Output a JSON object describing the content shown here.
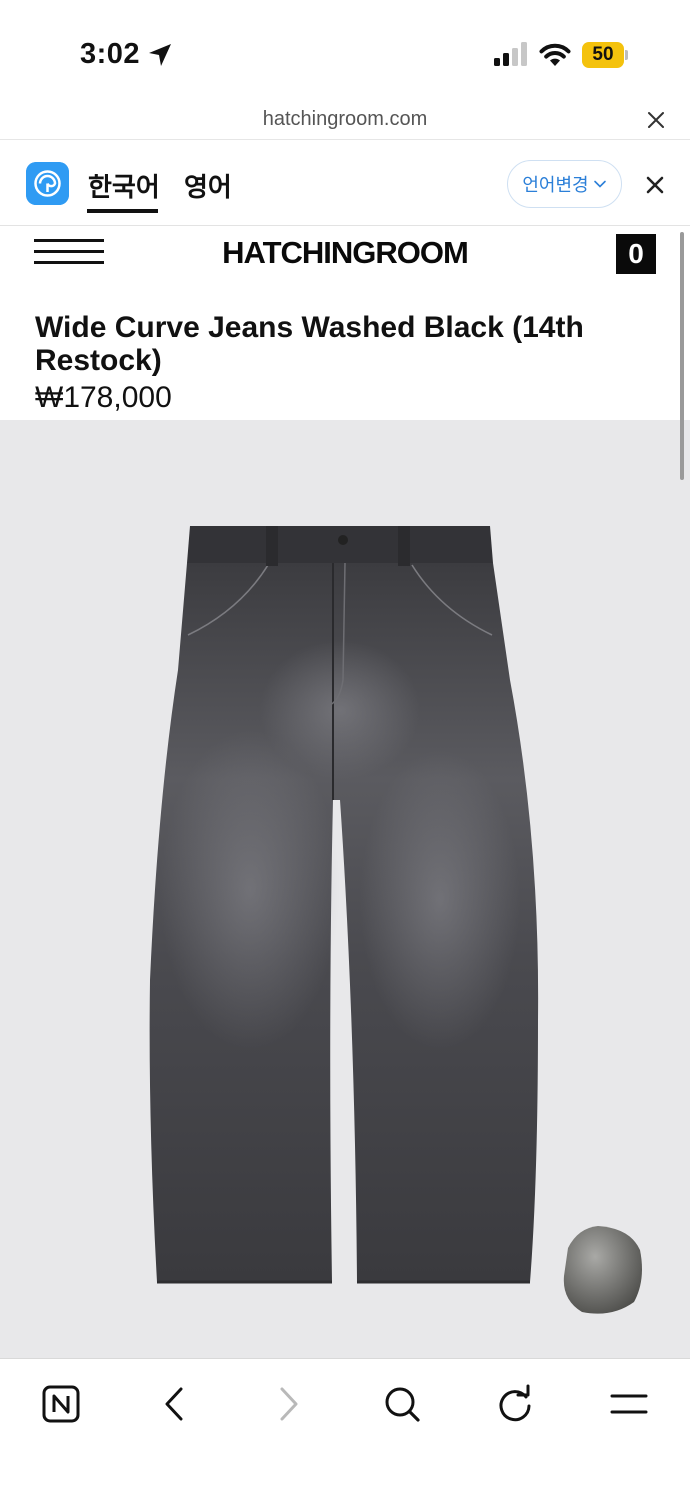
{
  "status_bar": {
    "time": "3:02",
    "battery": "50",
    "battery_color": "#f4c20d"
  },
  "browser": {
    "url": "hatchingroom.com"
  },
  "translate_bar": {
    "tab_korean": "한국어",
    "tab_english": "영어",
    "change_language": "언어변경",
    "accent_color": "#2b7fd8"
  },
  "site": {
    "brand": "HATCHINGROOM",
    "cart_count": "0"
  },
  "product": {
    "title": "Wide Curve Jeans Washed Black (14th Restock)",
    "price": "₩178,000"
  },
  "toolbar": {
    "items": [
      "naver-home-icon",
      "back-icon",
      "forward-icon",
      "search-icon",
      "reload-icon",
      "menu-icon"
    ]
  }
}
